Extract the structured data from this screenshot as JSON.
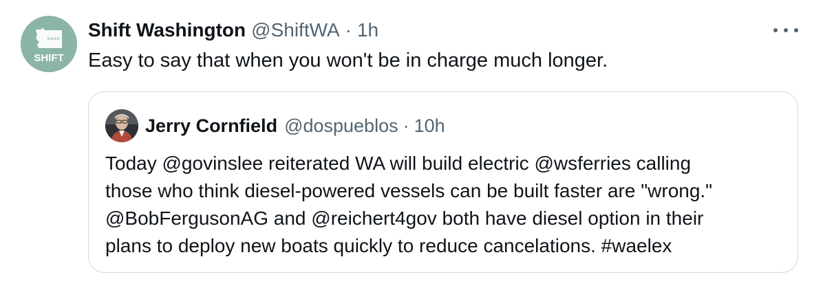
{
  "post": {
    "author": {
      "display_name": "Shift Washington",
      "handle": "@ShiftWA",
      "separator": "·",
      "time": "1h",
      "avatar_label": "SHIFT",
      "avatar_color": "#8bb5a8"
    },
    "text": "Easy to say that when you won't be in charge much longer.",
    "more_icon": "ellipsis-icon"
  },
  "quoted_post": {
    "author": {
      "display_name": "Jerry Cornfield",
      "handle": "@dospueblos",
      "separator": "·",
      "time": "10h"
    },
    "text_lines": [
      "Today @govinslee reiterated WA will build electric  @wsferries calling",
      "those who think diesel-powered vessels can be built faster are \"wrong.\"",
      "@BobFergusonAG and @reichert4gov both have diesel option in their",
      "plans to deploy new boats quickly to reduce cancelations. #waelex"
    ]
  },
  "colors": {
    "text_primary": "#0f1419",
    "text_secondary": "#536471",
    "border": "#cfd9de"
  }
}
